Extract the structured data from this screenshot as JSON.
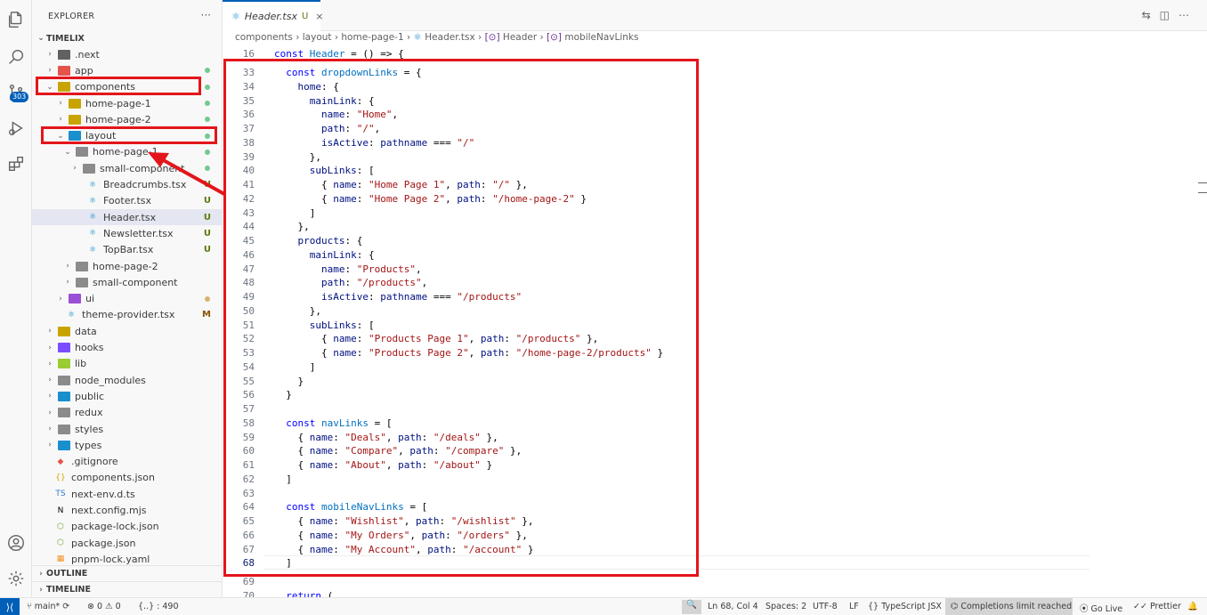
{
  "explorer": {
    "title": "EXPLORER",
    "more": "···",
    "project": "TIMELIX",
    "outline": "OUTLINE",
    "timeline": "TIMELINE",
    "items": [
      {
        "label": ".next"
      },
      {
        "label": "app"
      },
      {
        "label": "components"
      },
      {
        "label": "home-page-1"
      },
      {
        "label": "home-page-2"
      },
      {
        "label": "layout"
      },
      {
        "label": "home-page-1"
      },
      {
        "label": "small-component"
      },
      {
        "label": "Breadcrumbs.tsx",
        "status": "U"
      },
      {
        "label": "Footer.tsx",
        "status": "U"
      },
      {
        "label": "Header.tsx",
        "status": "U"
      },
      {
        "label": "Newsletter.tsx",
        "status": "U"
      },
      {
        "label": "TopBar.tsx",
        "status": "U"
      },
      {
        "label": "home-page-2"
      },
      {
        "label": "small-component"
      },
      {
        "label": "ui"
      },
      {
        "label": "theme-provider.tsx",
        "status": "M"
      },
      {
        "label": "data"
      },
      {
        "label": "hooks"
      },
      {
        "label": "lib"
      },
      {
        "label": "node_modules"
      },
      {
        "label": "public"
      },
      {
        "label": "redux"
      },
      {
        "label": "styles"
      },
      {
        "label": "types"
      },
      {
        "label": ".gitignore"
      },
      {
        "label": "components.json"
      },
      {
        "label": "next-env.d.ts"
      },
      {
        "label": "next.config.mjs"
      },
      {
        "label": "package-lock.json"
      },
      {
        "label": "package.json"
      },
      {
        "label": "pnpm-lock.yaml"
      }
    ]
  },
  "activity": {
    "badge": "303"
  },
  "tab": {
    "name": "Header.tsx",
    "status": "U",
    "close": "×"
  },
  "breadcrumb": [
    "components",
    "layout",
    "home-page-1",
    "Header.tsx",
    "Header",
    "mobileNavLinks"
  ],
  "code": {
    "lines": [
      {
        "n": "16",
        "t": "const Header = () => {"
      },
      {
        "n": "33",
        "t": "  const dropdownLinks = {"
      },
      {
        "n": "34",
        "t": "    home: {"
      },
      {
        "n": "35",
        "t": "      mainLink: {"
      },
      {
        "n": "36",
        "t": "        name: \"Home\","
      },
      {
        "n": "37",
        "t": "        path: \"/\","
      },
      {
        "n": "38",
        "t": "        isActive: pathname === \"/\""
      },
      {
        "n": "39",
        "t": "      },"
      },
      {
        "n": "40",
        "t": "      subLinks: ["
      },
      {
        "n": "41",
        "t": "        { name: \"Home Page 1\", path: \"/\" },"
      },
      {
        "n": "42",
        "t": "        { name: \"Home Page 2\", path: \"/home-page-2\" }"
      },
      {
        "n": "43",
        "t": "      ]"
      },
      {
        "n": "44",
        "t": "    },"
      },
      {
        "n": "45",
        "t": "    products: {"
      },
      {
        "n": "46",
        "t": "      mainLink: {"
      },
      {
        "n": "47",
        "t": "        name: \"Products\","
      },
      {
        "n": "48",
        "t": "        path: \"/products\","
      },
      {
        "n": "49",
        "t": "        isActive: pathname === \"/products\""
      },
      {
        "n": "50",
        "t": "      },"
      },
      {
        "n": "51",
        "t": "      subLinks: ["
      },
      {
        "n": "52",
        "t": "        { name: \"Products Page 1\", path: \"/products\" },"
      },
      {
        "n": "53",
        "t": "        { name: \"Products Page 2\", path: \"/home-page-2/products\" }"
      },
      {
        "n": "54",
        "t": "      ]"
      },
      {
        "n": "55",
        "t": "    }"
      },
      {
        "n": "56",
        "t": "  }"
      },
      {
        "n": "57",
        "t": ""
      },
      {
        "n": "58",
        "t": "  const navLinks = ["
      },
      {
        "n": "59",
        "t": "    { name: \"Deals\", path: \"/deals\" },"
      },
      {
        "n": "60",
        "t": "    { name: \"Compare\", path: \"/compare\" },"
      },
      {
        "n": "61",
        "t": "    { name: \"About\", path: \"/about\" }"
      },
      {
        "n": "62",
        "t": "  ]"
      },
      {
        "n": "63",
        "t": ""
      },
      {
        "n": "64",
        "t": "  const mobileNavLinks = ["
      },
      {
        "n": "65",
        "t": "    { name: \"Wishlist\", path: \"/wishlist\" },"
      },
      {
        "n": "66",
        "t": "    { name: \"My Orders\", path: \"/orders\" },"
      },
      {
        "n": "67",
        "t": "    { name: \"My Account\", path: \"/account\" }"
      },
      {
        "n": "68",
        "t": "  ]"
      },
      {
        "n": "69",
        "t": ""
      },
      {
        "n": "70",
        "t": "  return ("
      }
    ]
  },
  "status": {
    "branch": "main*",
    "errors": "0",
    "warnings": "0",
    "info": "{..} : 490",
    "position": "Ln 68, Col 4",
    "spaces": "Spaces: 2",
    "encoding": "UTF-8",
    "eol": "LF",
    "language": "TypeScript JSX",
    "completions": "Completions limit reached",
    "golive": "Go Live",
    "prettier": "Prettier"
  },
  "colors": {
    "accent": "#005fb8",
    "highlight": "#e3151b",
    "added": "#587c0c",
    "modified": "#895503"
  }
}
